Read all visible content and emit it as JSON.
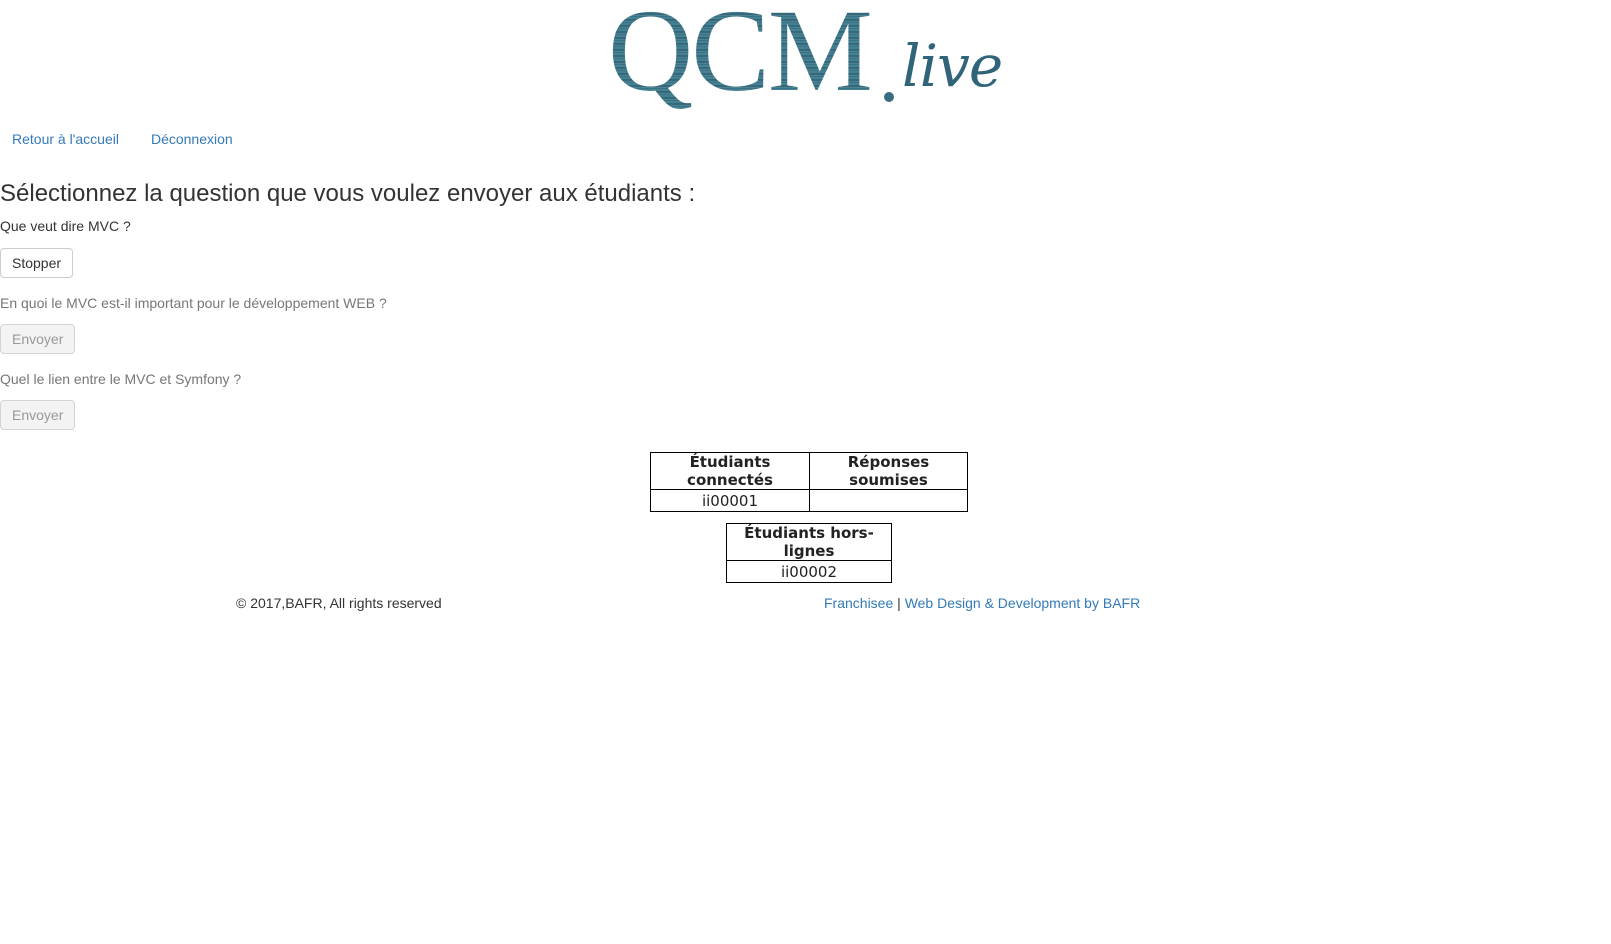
{
  "logo": {
    "main": "QCM",
    "suffix": "live"
  },
  "nav": {
    "home": "Retour à l'accueil",
    "logout": "Déconnexion"
  },
  "main": {
    "title": "Sélectionnez la question que vous voulez envoyer aux étudiants :",
    "questions": [
      {
        "text": "Que veut dire MVC ?",
        "button": "Stopper",
        "state": "active"
      },
      {
        "text": "En quoi le MVC est-il important pour le développement WEB ?",
        "button": "Envoyer",
        "state": "disabled"
      },
      {
        "text": "Quel le lien entre le MVC et Symfony ?",
        "button": "Envoyer",
        "state": "disabled"
      }
    ]
  },
  "connected_table": {
    "headers": [
      "Étudiants connectés",
      "Réponses soumises"
    ],
    "rows": [
      [
        "ii00001",
        ""
      ]
    ]
  },
  "offline_table": {
    "header": "Étudiants hors-lignes",
    "rows": [
      "ii00002"
    ]
  },
  "footer": {
    "copyright": "© 2017,BAFR, All rights reserved",
    "franchise_link": "Franchisee",
    "separator": "|",
    "credit_link": "Web Design & Development by BAFR"
  },
  "colors": {
    "link": "#337ab7",
    "logo": "#3d6e85",
    "text": "#333333"
  }
}
